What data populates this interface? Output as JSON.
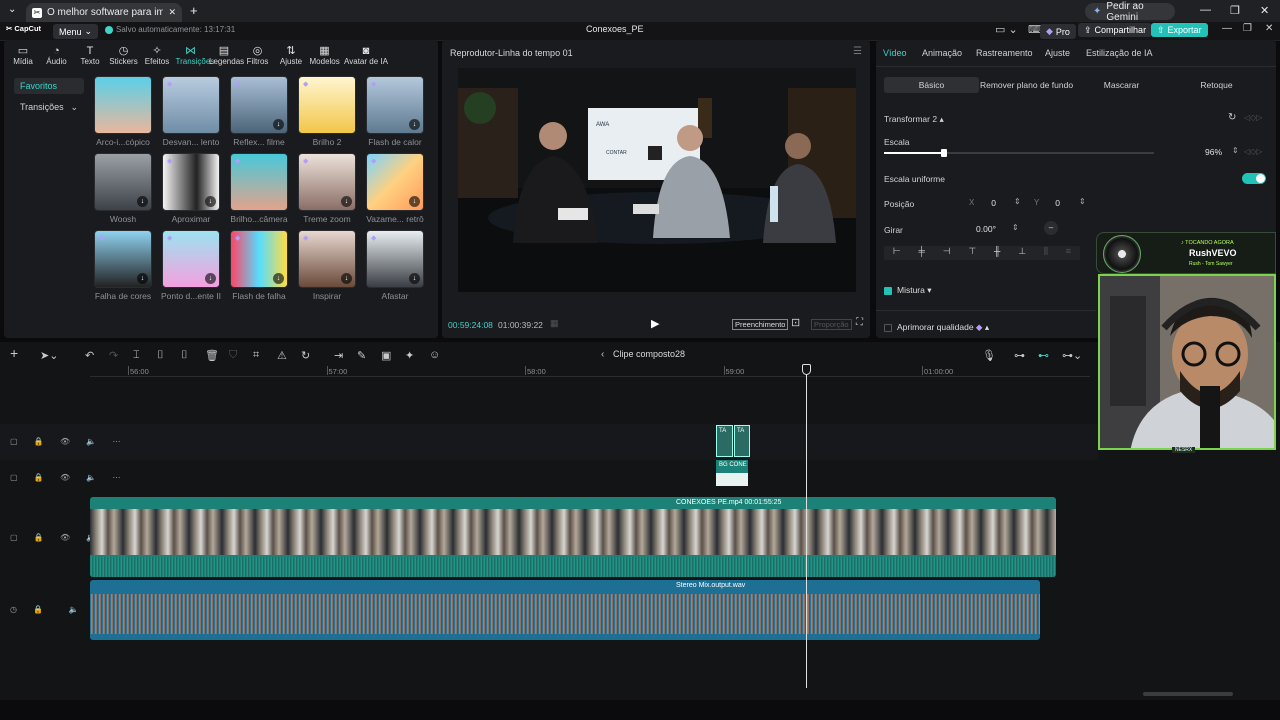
{
  "browser": {
    "tab_title": "O melhor software para impuls",
    "tab_close": "✕",
    "new_tab": "+",
    "gemini_button": "Pedir ao Gemini"
  },
  "app": {
    "logo": "CapCut",
    "menu": "Menu",
    "autosave": "Salvo automaticamente: 13:17:31",
    "project_title": "Conexoes_PE",
    "pro_badge": "Pro",
    "share": "Compartilhar",
    "export": "Exportar"
  },
  "categories": [
    {
      "label": "Mídia",
      "icon": "▭"
    },
    {
      "label": "Áudio",
      "icon": "◔"
    },
    {
      "label": "Texto",
      "icon": "T"
    },
    {
      "label": "Stickers",
      "icon": "◷"
    },
    {
      "label": "Efeitos",
      "icon": "✧"
    },
    {
      "label": "Transições",
      "icon": "⋈"
    },
    {
      "label": "Legendas",
      "icon": "▤"
    },
    {
      "label": "Filtros",
      "icon": "◎"
    },
    {
      "label": "Ajuste",
      "icon": "⇅"
    },
    {
      "label": "Modelos",
      "icon": "▦"
    },
    {
      "label": "Avatar de IA",
      "icon": "◙"
    }
  ],
  "sidebar": {
    "favorites": "Favoritos",
    "transitions": "Transições"
  },
  "transitions": [
    {
      "label": "Arco-i...cópico"
    },
    {
      "label": "Desvan... lento"
    },
    {
      "label": "Reflex... filme"
    },
    {
      "label": "Brilho 2"
    },
    {
      "label": "Flash de calor"
    },
    {
      "label": "Woosh"
    },
    {
      "label": "Aproximar"
    },
    {
      "label": "Brilho...câmera"
    },
    {
      "label": "Treme zoom"
    },
    {
      "label": "Vazame... retrô"
    },
    {
      "label": "Falha de cores"
    },
    {
      "label": "Ponto d...ente II"
    },
    {
      "label": "Flash de falha"
    },
    {
      "label": "Inspirar"
    },
    {
      "label": "Afastar"
    }
  ],
  "player": {
    "title": "Reprodutor-Linha do tempo 01",
    "current_time": "00:59:24:08",
    "total_time": "01:00:39:22",
    "fill_label": "Preenchimento",
    "aspect_label": "Proporção",
    "scene_logos": [
      "AWA",
      "CONTAR"
    ]
  },
  "props": {
    "tabs": [
      "Vídeo",
      "Animação",
      "Rastreamento",
      "Ajuste",
      "Estilização de IA"
    ],
    "subtabs": [
      "Básico",
      "Remover plano de fundo",
      "Mascarar",
      "Retoque"
    ],
    "transform_label": "Transformar 2",
    "scale_label": "Escala",
    "scale_value": "96%",
    "scale_fraction": 0.96,
    "uniform_label": "Escala uniforme",
    "position_label": "Posição",
    "x_label": "X",
    "x_value": "0",
    "y_label": "Y",
    "y_value": "0",
    "rotate_label": "Girar",
    "rotate_value": "0.00°",
    "blend_label": "Mistura",
    "enhance_label": "Aprimorar qualidade"
  },
  "timeline": {
    "compound_label": "Clipe composto28",
    "ruler": [
      "56:00",
      "57:00",
      "58:00",
      "59:00",
      "01:00:00"
    ],
    "clip_small_a": "TA",
    "clip_small_b": "TA",
    "clip_bg": "BG CONE",
    "main_clip": "CONEXOES PE.mp4   00:01:55:25",
    "audio_clip": "Stereo Mix.output.wav"
  },
  "webcam": {
    "header_small": "♪ TOCANDO AGORA",
    "header_name": "RushVEVO",
    "header_sub": "Rush - Tom Sawyer",
    "tag": "NESRX"
  },
  "colors": {
    "accent": "#3fd4c8",
    "export_bg": "#22c2b8",
    "video_track": "#1c8278",
    "audio_track": "#1d6f93",
    "panel": "#1a1b1e"
  }
}
